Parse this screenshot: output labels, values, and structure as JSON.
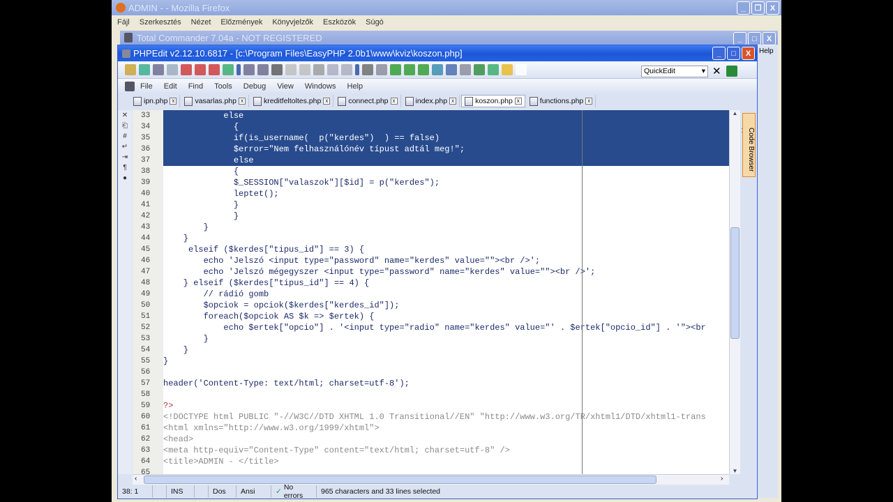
{
  "firefox": {
    "title": "ADMIN - - Mozilla Firefox",
    "menu": [
      "Fájl",
      "Szerkesztés",
      "Nézet",
      "Előzmények",
      "Könyvjelzők",
      "Eszközök",
      "Súgó"
    ]
  },
  "totalcmd": {
    "title": "Total Commander 7.04a - NOT REGISTERED",
    "side_label": "Help"
  },
  "phpedit": {
    "title": "PHPEdit v2.12.10.6817 - [c:\\Program Files\\EasyPHP 2.0b1\\www\\kviz\\koszon.php]",
    "quickedit": "QuickEdit",
    "menu": [
      "File",
      "Edit",
      "Find",
      "Tools",
      "Debug",
      "View",
      "Windows",
      "Help"
    ],
    "tabs": [
      {
        "label": "ipn.php"
      },
      {
        "label": "vasarlas.php"
      },
      {
        "label": "kreditfeltoltes.php"
      },
      {
        "label": "connect.php"
      },
      {
        "label": "index.php"
      },
      {
        "label": "koszon.php",
        "active": true
      },
      {
        "label": "functions.php"
      }
    ],
    "code_browser_label": "Code Browser",
    "lines": [
      {
        "n": "33",
        "t": "            else",
        "sel": true
      },
      {
        "n": "34",
        "t": "              {",
        "sel": true
      },
      {
        "n": "35",
        "t": "              if(is_username(  p(\"kerdes\")  ) == false)",
        "sel": true
      },
      {
        "n": "36",
        "t": "              $error=\"Nem felhasználónév típust adtál meg!\";",
        "sel": true
      },
      {
        "n": "37",
        "t": "              else",
        "sel": true
      },
      {
        "n": "38",
        "t": "              {"
      },
      {
        "n": "39",
        "t": "              $_SESSION[\"valaszok\"][$id] = p(\"kerdes\");"
      },
      {
        "n": "40",
        "t": "              leptet();"
      },
      {
        "n": "41",
        "t": "              }"
      },
      {
        "n": "42",
        "t": "              }"
      },
      {
        "n": "43",
        "t": "        }"
      },
      {
        "n": "44",
        "t": "    }"
      },
      {
        "n": "45",
        "t": "     elseif ($kerdes[\"tipus_id\"] == 3) {"
      },
      {
        "n": "46",
        "t": "        echo 'Jelszó <input type=\"password\" name=\"kerdes\" value=\"\"><br />';"
      },
      {
        "n": "47",
        "t": "        echo 'Jelszó mégegyszer <input type=\"password\" name=\"kerdes\" value=\"\"><br />';"
      },
      {
        "n": "48",
        "t": "    } elseif ($kerdes[\"tipus_id\"] == 4) {"
      },
      {
        "n": "49",
        "t": "        // rádió gomb"
      },
      {
        "n": "50",
        "t": "        $opciok = opciok($kerdes[\"kerdes_id\"]);"
      },
      {
        "n": "51",
        "t": "        foreach($opciok AS $k => $ertek) {"
      },
      {
        "n": "52",
        "t": "            echo $ertek[\"opcio\"] . '<input type=\"radio\" name=\"kerdes\" value=\"' . $ertek[\"opcio_id\"] . '\"><br"
      },
      {
        "n": "53",
        "t": "        }"
      },
      {
        "n": "54",
        "t": "    }"
      },
      {
        "n": "55",
        "t": "}"
      },
      {
        "n": "56",
        "t": ""
      },
      {
        "n": "57",
        "t": "header('Content-Type: text/html; charset=utf-8');"
      },
      {
        "n": "58",
        "t": ""
      },
      {
        "n": "59",
        "t": "?>",
        "kind": "tag"
      },
      {
        "n": "60",
        "t": "<!DOCTYPE html PUBLIC \"-//W3C//DTD XHTML 1.0 Transitional//EN\" \"http://www.w3.org/TR/xhtml1/DTD/xhtml1-trans",
        "kind": "html"
      },
      {
        "n": "61",
        "t": "<html xmlns=\"http://www.w3.org/1999/xhtml\">",
        "kind": "html"
      },
      {
        "n": "62",
        "t": "<head>",
        "kind": "html"
      },
      {
        "n": "63",
        "t": "<meta http-equiv=\"Content-Type\" content=\"text/html; charset=utf-8\" />",
        "kind": "html"
      },
      {
        "n": "64",
        "t": "<title>ADMIN - </title>",
        "kind": "html"
      },
      {
        "n": "65",
        "t": "",
        "kind": "html"
      }
    ],
    "status": {
      "position": "38:  1",
      "mode": "INS",
      "lineend": "Dos",
      "encoding": "Ansi",
      "errors": "No errors",
      "selection": "965 characters and 33 lines selected"
    }
  }
}
